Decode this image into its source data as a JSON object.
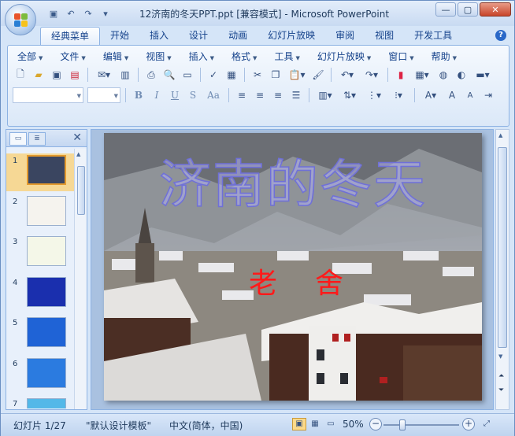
{
  "window": {
    "title": "12济南的冬天PPT.ppt [兼容模式] - Microsoft PowerPoint"
  },
  "icons": {
    "office": "office-logo-icon",
    "save": "save-icon",
    "undo": "undo-icon",
    "redo": "redo-icon",
    "customize": "customize-qat-icon",
    "minimize": "minimize-icon",
    "maximize": "maximize-icon",
    "close": "close-icon",
    "help": "help-icon"
  },
  "ribbon_tabs": [
    {
      "label": "经典菜单",
      "active": true
    },
    {
      "label": "开始"
    },
    {
      "label": "插入"
    },
    {
      "label": "设计"
    },
    {
      "label": "动画"
    },
    {
      "label": "幻灯片放映"
    },
    {
      "label": "审阅"
    },
    {
      "label": "视图"
    },
    {
      "label": "开发工具"
    }
  ],
  "menus": [
    "全部",
    "文件",
    "编辑",
    "视图",
    "插入",
    "格式",
    "工具",
    "幻灯片放映",
    "窗口",
    "帮助"
  ],
  "toolbar2": {
    "font_name": "",
    "font_size": "",
    "bold": "B",
    "italic": "I",
    "underline": "U",
    "shadow": "S",
    "case": "Aa"
  },
  "panel": {
    "close": "✕"
  },
  "thumbnails": [
    {
      "num": "1",
      "selected": true,
      "bg": "#3a4560"
    },
    {
      "num": "2",
      "bg": "#f5f3ee"
    },
    {
      "num": "3",
      "bg": "#f4f7e8"
    },
    {
      "num": "4",
      "bg": "#1a2fae"
    },
    {
      "num": "5",
      "bg": "#1f63d6"
    },
    {
      "num": "6",
      "bg": "#2b7be0"
    },
    {
      "num": "7",
      "bg": "#53b8e8"
    }
  ],
  "slide": {
    "title": "济南的冬天",
    "author": "老舍"
  },
  "status": {
    "slide_info": "幻灯片 1/27",
    "theme": "\"默认设计模板\"",
    "language": "中文(简体，中国)",
    "zoom": "50%",
    "zoom_level": 0.5
  }
}
